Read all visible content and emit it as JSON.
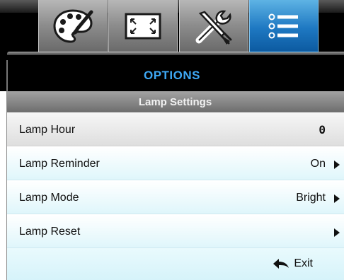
{
  "tabs": [
    {
      "id": "display",
      "icon": "palette-icon",
      "active": false
    },
    {
      "id": "screen",
      "icon": "screen-resize-icon",
      "active": false
    },
    {
      "id": "setup",
      "icon": "tools-icon",
      "active": false
    },
    {
      "id": "options",
      "icon": "list-menu-icon",
      "active": true
    }
  ],
  "menu": {
    "title": "OPTIONS",
    "section": "Lamp Settings",
    "items": [
      {
        "label": "Lamp Hour",
        "value": "0",
        "has_arrow": false
      },
      {
        "label": "Lamp Reminder",
        "value": "On",
        "has_arrow": true
      },
      {
        "label": "Lamp Mode",
        "value": "Bright",
        "has_arrow": true
      },
      {
        "label": "Lamp Reset",
        "value": "",
        "has_arrow": true
      }
    ],
    "exit_label": "Exit",
    "exit_icon": "back-arrow-icon"
  },
  "colors": {
    "title": "#3ea8f4",
    "active_tab": "#1e78c2",
    "row_highlight": "#dff6fb"
  }
}
